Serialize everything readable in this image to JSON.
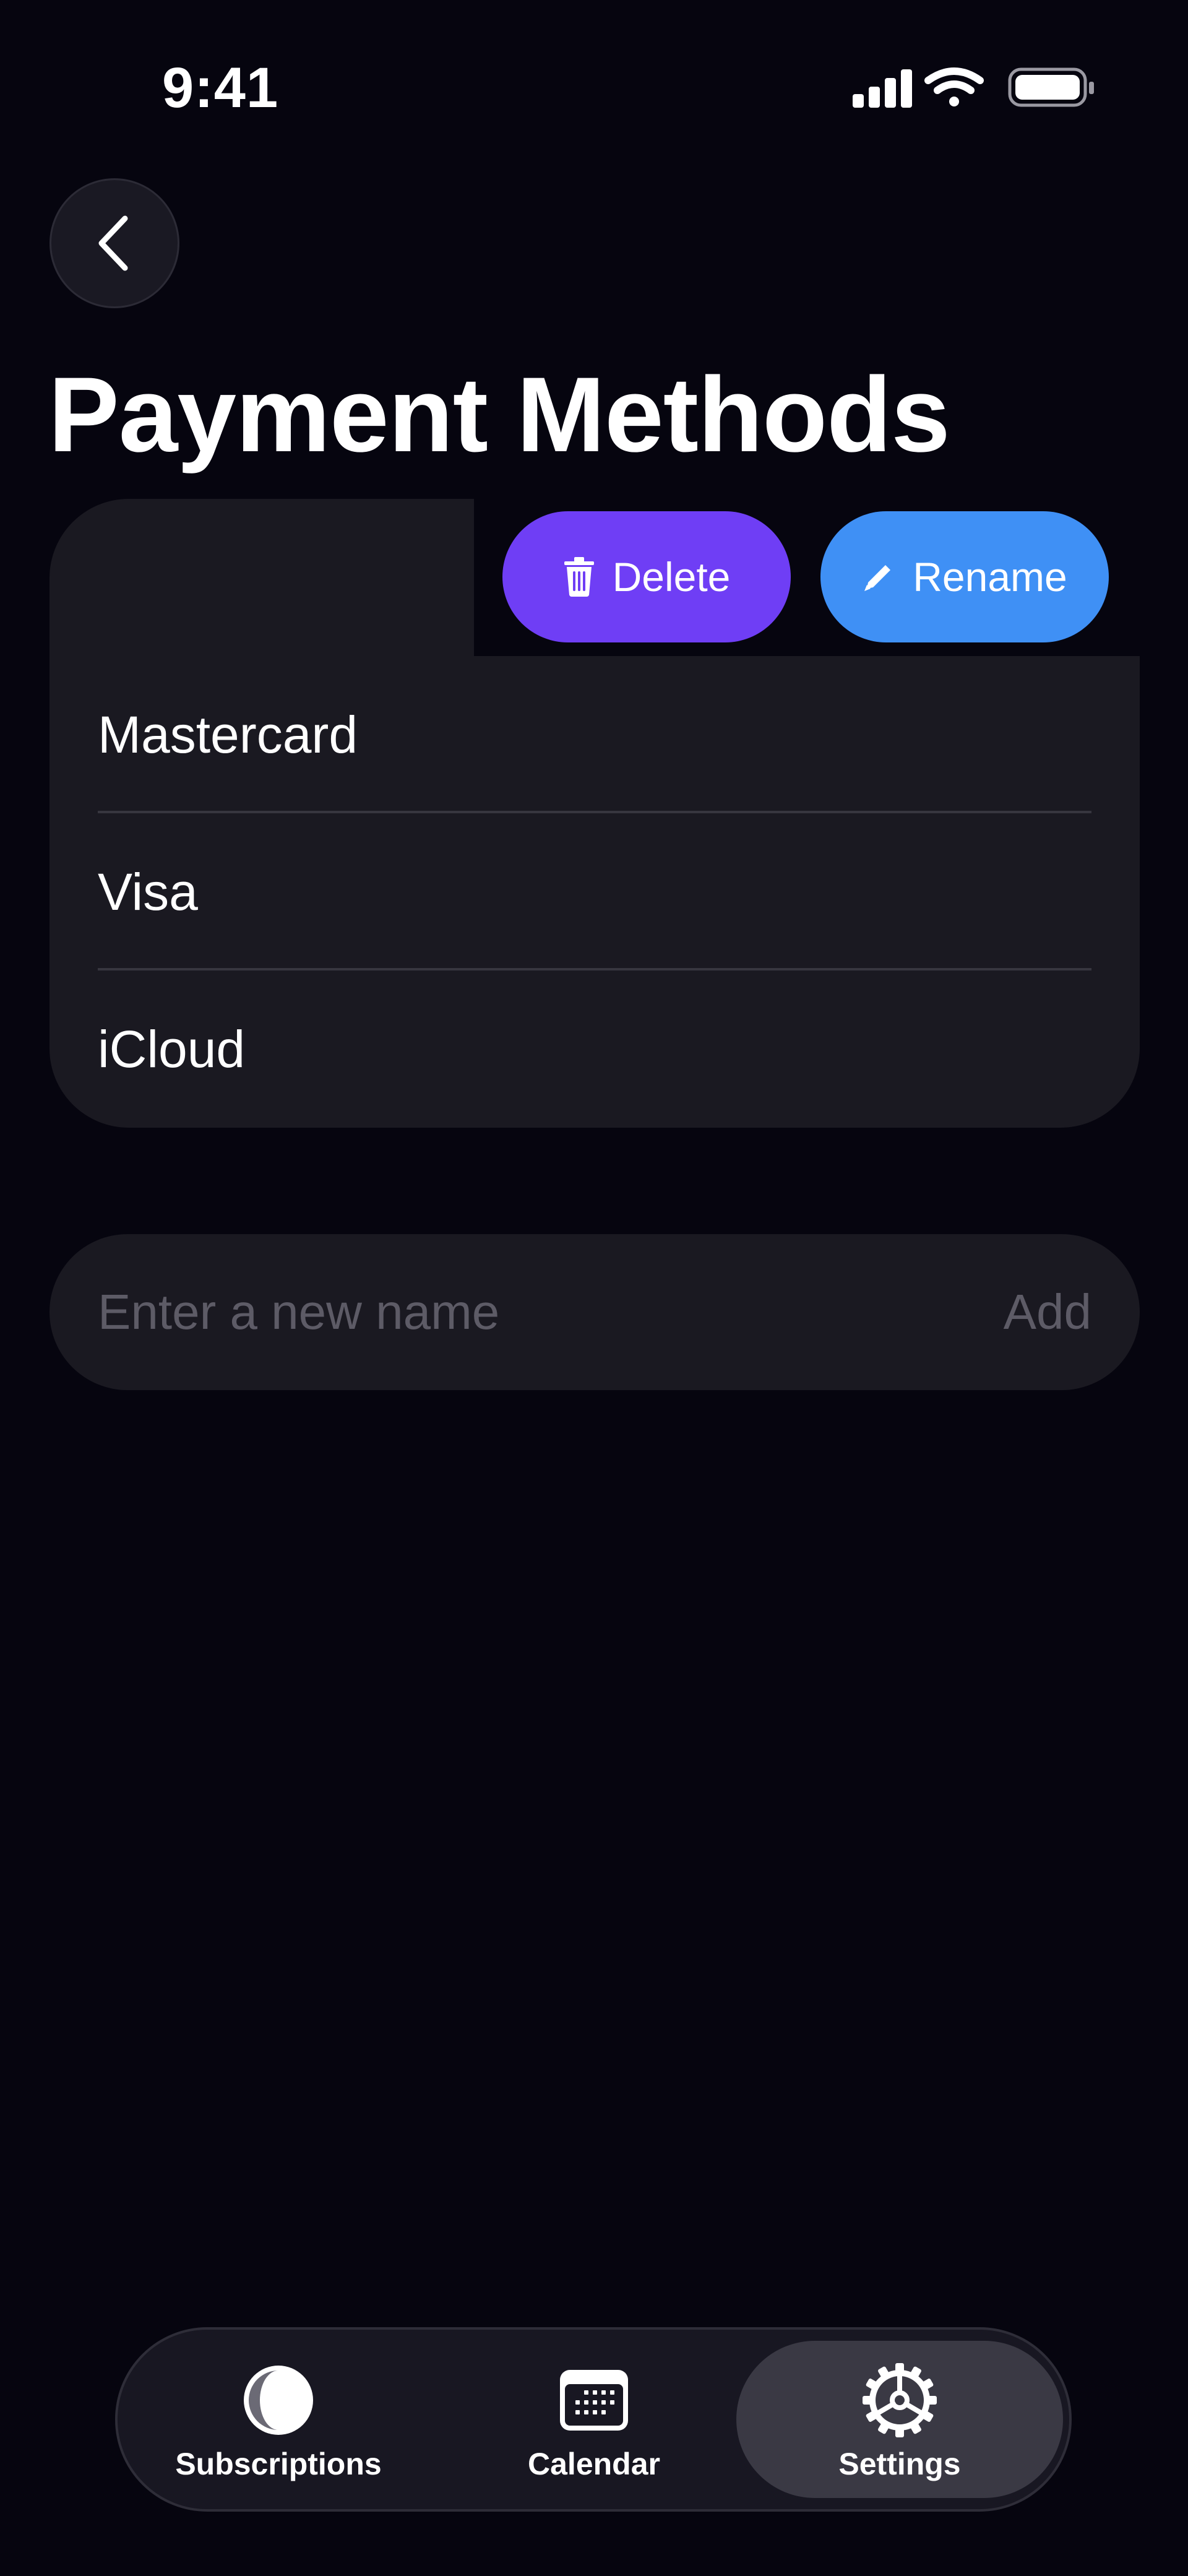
{
  "status_bar": {
    "time": "9:41",
    "icons": [
      "cellular-signal-icon",
      "wifi-icon",
      "battery-icon"
    ]
  },
  "header": {
    "back_icon": "chevron-left-icon",
    "title": "Payment Methods"
  },
  "swipe_actions": {
    "delete_label": "Delete",
    "delete_icon": "trash-icon",
    "delete_color": "#6f3ef5",
    "rename_label": "Rename",
    "rename_icon": "pencil-icon",
    "rename_color": "#3f90f5"
  },
  "payment_methods": [
    {
      "label": "Mastercard"
    },
    {
      "label": "Visa"
    },
    {
      "label": "iCloud"
    }
  ],
  "new_method": {
    "value": "",
    "placeholder": "Enter a new name",
    "add_label": "Add"
  },
  "tab_bar": {
    "tabs": [
      {
        "label": "Subscriptions",
        "icon": "subscriptions-icon",
        "selected": false
      },
      {
        "label": "Calendar",
        "icon": "calendar-icon",
        "selected": false
      },
      {
        "label": "Settings",
        "icon": "gear-icon",
        "selected": true
      }
    ]
  },
  "colors": {
    "background": "#06050f",
    "card": "#1a1921",
    "placeholder": "#5d5b66"
  }
}
